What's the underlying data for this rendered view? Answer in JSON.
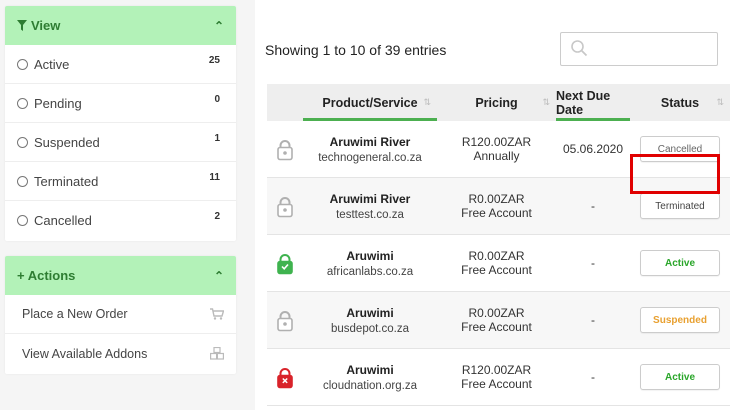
{
  "sidebar": {
    "view": {
      "title": "View",
      "items": [
        {
          "label": "Active",
          "count": "25"
        },
        {
          "label": "Pending",
          "count": "0"
        },
        {
          "label": "Suspended",
          "count": "1"
        },
        {
          "label": "Terminated",
          "count": "11"
        },
        {
          "label": "Cancelled",
          "count": "2"
        }
      ]
    },
    "actions": {
      "title": "+ Actions",
      "items": [
        {
          "label": "Place a New Order",
          "icon": "cart-icon"
        },
        {
          "label": "View Available Addons",
          "icon": "cubes-icon"
        }
      ]
    }
  },
  "main": {
    "showing": "Showing 1 to 10 of 39 entries",
    "search_placeholder": "",
    "columns": [
      "Product/Service",
      "Pricing",
      "Next Due Date",
      "Status"
    ],
    "rows": [
      {
        "product": "Aruwimi River",
        "domain": "technogeneral.co.za",
        "price": "R120.00ZAR",
        "cycle": "Annually",
        "due": "05.06.2020",
        "status": "Cancelled",
        "lock": "grey"
      },
      {
        "product": "Aruwimi River",
        "domain": "testtest.co.za",
        "price": "R0.00ZAR",
        "cycle": "Free Account",
        "due": "-",
        "status": "Terminated",
        "lock": "grey"
      },
      {
        "product": "Aruwimi",
        "domain": "africanlabs.co.za",
        "price": "R0.00ZAR",
        "cycle": "Free Account",
        "due": "-",
        "status": "Active",
        "lock": "green"
      },
      {
        "product": "Aruwimi",
        "domain": "busdepot.co.za",
        "price": "R0.00ZAR",
        "cycle": "Free Account",
        "due": "-",
        "status": "Suspended",
        "lock": "grey"
      },
      {
        "product": "Aruwimi",
        "domain": "cloudnation.org.za",
        "price": "R120.00ZAR",
        "cycle": "Free Account",
        "due": "-",
        "status": "Active",
        "lock": "red"
      }
    ]
  },
  "colors": {
    "accent_green": "#4caf50",
    "panel_header": "#b3f2b8",
    "highlight_red": "#e00000",
    "lock_grey": "#b0b0b0",
    "lock_green": "#3fb34f",
    "lock_red": "#d9232a"
  }
}
